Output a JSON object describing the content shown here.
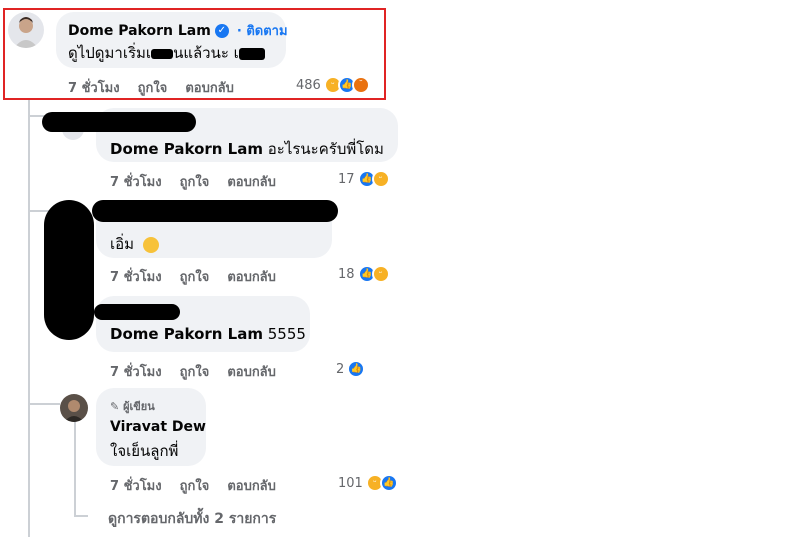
{
  "main_comment": {
    "author": "Dome Pakorn Lam",
    "follow_label": "· ติดตาม",
    "text": "ดูไปดูมาเริ่มเ",
    "text_mid": "นแล้วนะ เ",
    "time": "7 ชั่วโมง",
    "like_label": "ถูกใจ",
    "reply_label": "ตอบกลับ",
    "reaction_count": "486"
  },
  "replies": [
    {
      "author": "Dome Pakorn Lam",
      "text": "อะไรนะครับพี่โดม",
      "time": "7 ชั่วโมง",
      "like_label": "ถูกใจ",
      "reply_label": "ตอบกลับ",
      "reaction_count": "17"
    },
    {
      "author": "",
      "text": "เอิ่ม",
      "time": "7 ชั่วโมง",
      "like_label": "ถูกใจ",
      "reply_label": "ตอบกลับ",
      "reaction_count": "18"
    },
    {
      "author": "Dome Pakorn Lam",
      "text": "5555",
      "time": "7 ชั่วโมง",
      "like_label": "ถูกใจ",
      "reply_label": "ตอบกลับ",
      "reaction_count": "2"
    },
    {
      "badge": "ผู้เขียน",
      "author": "Viravat Dew",
      "text": "ใจเย็นลูกพี่",
      "time": "7 ชั่วโมง",
      "like_label": "ถูกใจ",
      "reply_label": "ตอบกลับ",
      "reaction_count": "101"
    }
  ],
  "view_more": "ดูการตอบกลับทั้ง 2 รายการ",
  "colors": {
    "link": "#1877f2",
    "highlight": "#e02424",
    "bubble": "#f0f2f5",
    "meta": "#65676b"
  }
}
